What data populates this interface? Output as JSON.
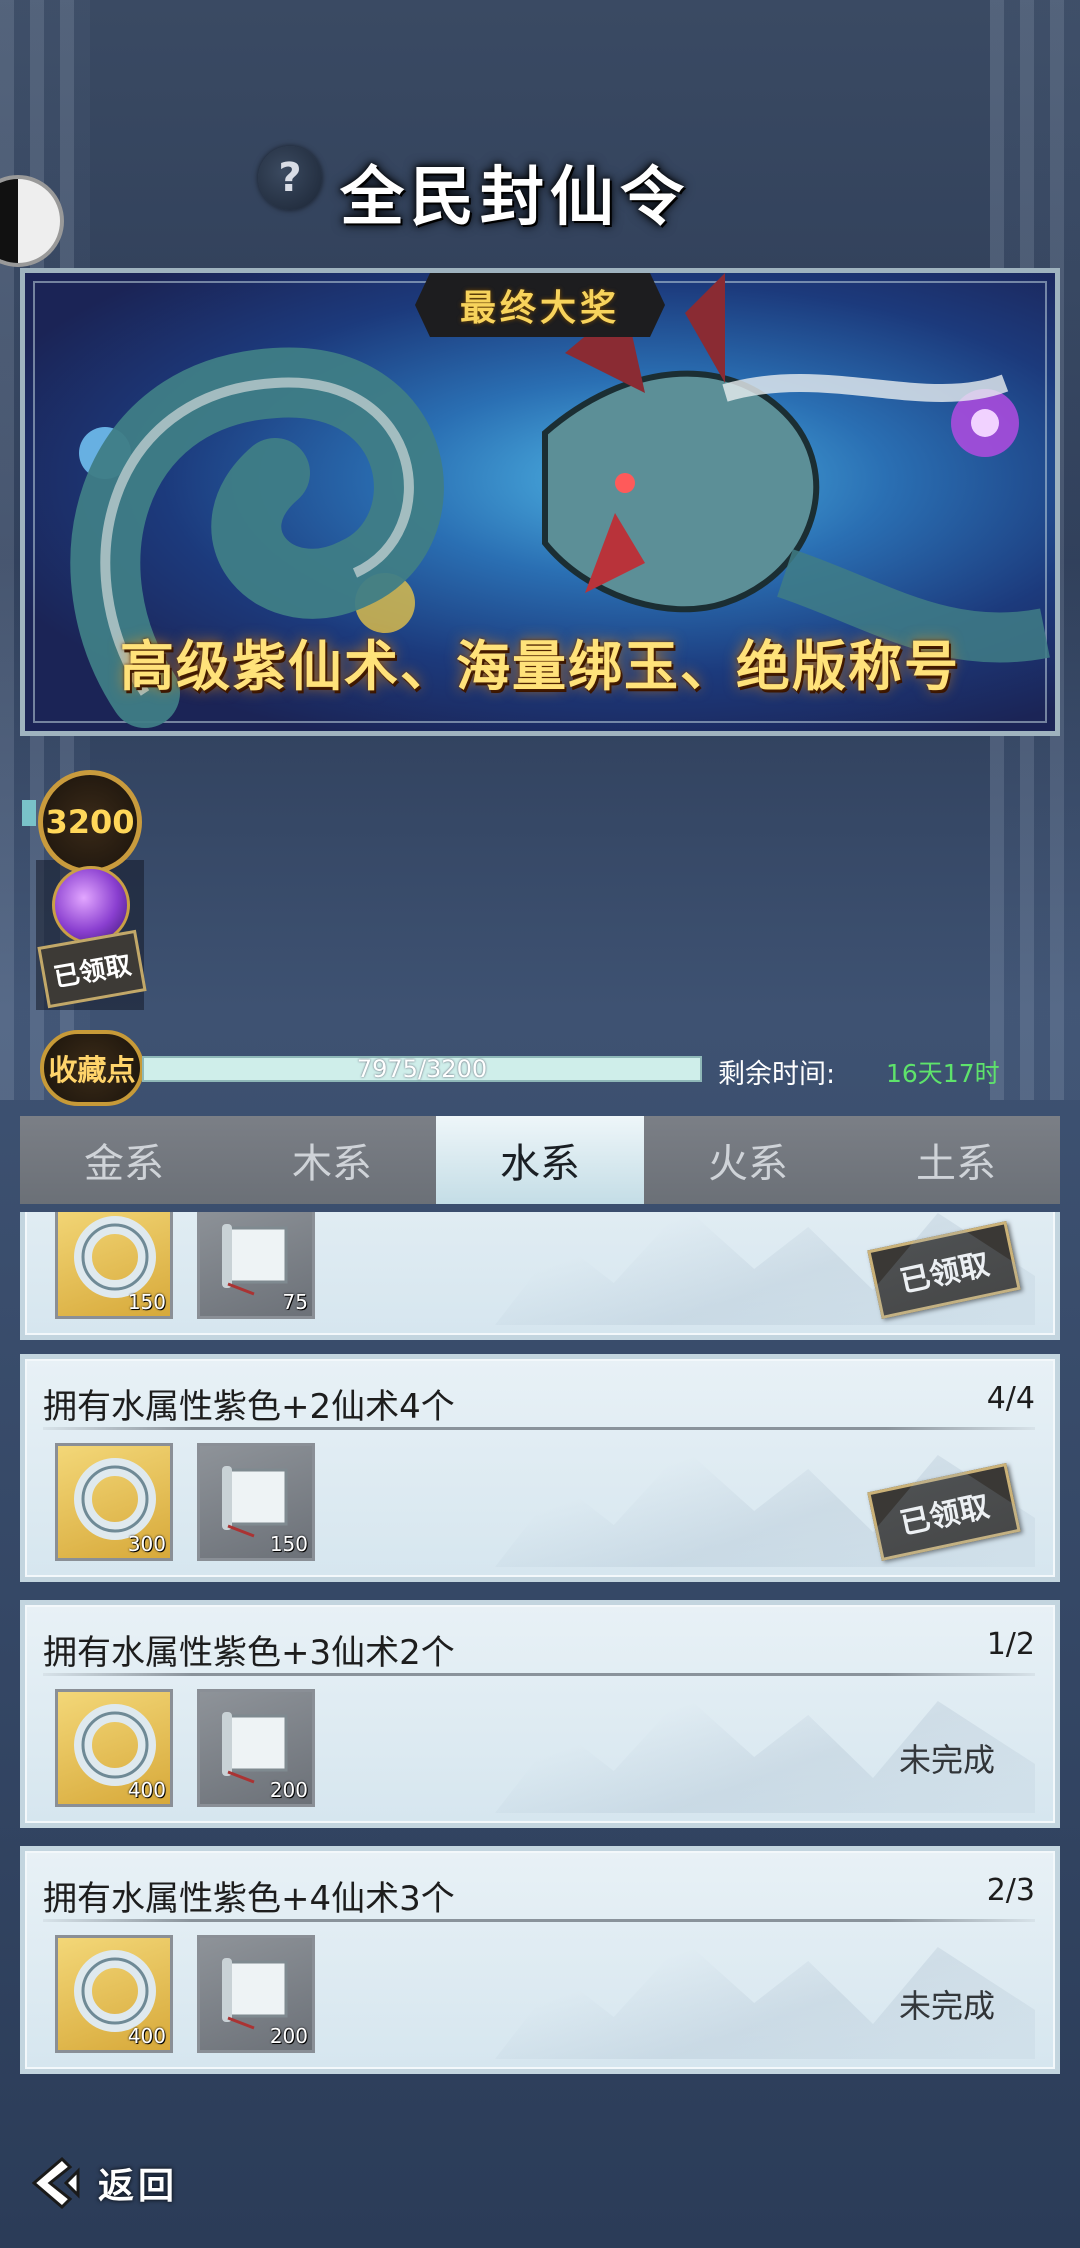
{
  "header": {
    "title": "全民封仙令",
    "help_label": "?"
  },
  "banner": {
    "ribbon": "最终大奖",
    "caption": "高级紫仙术、海量绑玉、绝版称号"
  },
  "milestone": {
    "points": "3200",
    "stamp": "已领取"
  },
  "progress": {
    "badge": "收藏点",
    "value_text": "7975/3200",
    "fill_fraction": 1.0,
    "remaining_label": "剩余时间:",
    "remaining_value": "16天17时"
  },
  "tabs": [
    {
      "label": "金系",
      "active": false
    },
    {
      "label": "木系",
      "active": false
    },
    {
      "label": "水系",
      "active": true
    },
    {
      "label": "火系",
      "active": false
    },
    {
      "label": "土系",
      "active": false
    }
  ],
  "tasks": [
    {
      "title": "",
      "progress": "",
      "jade_qty": "150",
      "scroll_qty": "75",
      "status": "已领取",
      "claimed": true
    },
    {
      "title": "拥有水属性紫色+2仙术4个",
      "progress": "4/4",
      "jade_qty": "300",
      "scroll_qty": "150",
      "status": "已领取",
      "claimed": true
    },
    {
      "title": "拥有水属性紫色+3仙术2个",
      "progress": "1/2",
      "jade_qty": "400",
      "scroll_qty": "200",
      "status": "未完成",
      "claimed": false
    },
    {
      "title": "拥有水属性紫色+4仙术3个",
      "progress": "2/3",
      "jade_qty": "400",
      "scroll_qty": "200",
      "status": "未完成",
      "claimed": false
    }
  ],
  "footer": {
    "back_label": "返回"
  },
  "colors": {
    "accent_gold": "#ffd46b",
    "remaining_green": "#5ee36b",
    "active_tab": "#c4dde6"
  }
}
